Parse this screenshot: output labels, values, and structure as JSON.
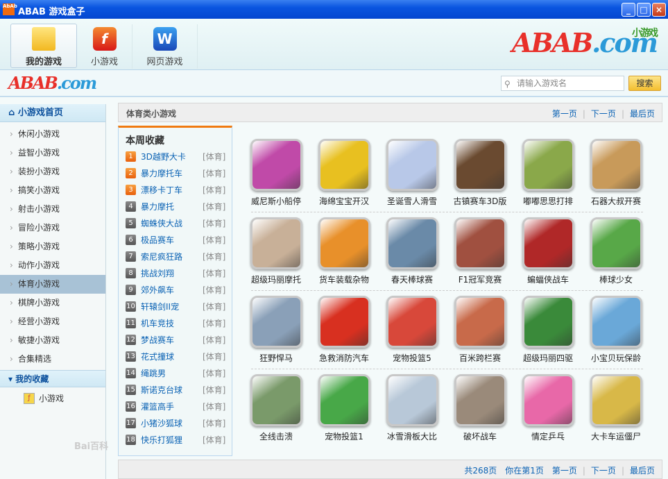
{
  "window": {
    "title": "ABAB  游戏盒子",
    "app_icon": "AbAb",
    "minimize": "_",
    "maximize": "□",
    "close": "×"
  },
  "toolbar": {
    "tabs": [
      {
        "label": "我的游戏",
        "icon": "folder-icon"
      },
      {
        "label": "小游戏",
        "icon": "flash-icon",
        "glyph": "f"
      },
      {
        "label": "网页游戏",
        "icon": "web-icon",
        "glyph": "W"
      }
    ],
    "brand_logo": {
      "main": "ABAB",
      "dot": ".com",
      "sub": "小游戏"
    }
  },
  "search": {
    "placeholder": "请输入游戏名",
    "button": "搜索"
  },
  "sidebar": {
    "home": "小游戏首页",
    "items": [
      "休闲小游戏",
      "益智小游戏",
      "装扮小游戏",
      "搞笑小游戏",
      "射击小游戏",
      "冒险小游戏",
      "策略小游戏",
      "动作小游戏",
      "体育小游戏",
      "棋牌小游戏",
      "经营小游戏",
      "敏捷小游戏",
      "合集精选"
    ],
    "active_index": 8,
    "favorites_header": "我的收藏",
    "favorites": [
      "小游戏"
    ]
  },
  "main": {
    "title": "体育类小游戏",
    "pager": {
      "first": "第一页",
      "next": "下一页",
      "last": "最后页"
    },
    "footer": {
      "total": "共268页",
      "current": "你在第1页",
      "first": "第一页",
      "next": "下一页",
      "last": "最后页"
    }
  },
  "weekly": {
    "title": "本周收藏",
    "items": [
      {
        "n": "1",
        "name": "3D越野大卡",
        "cat": "[体育]"
      },
      {
        "n": "2",
        "name": "暴力摩托车",
        "cat": "[体育]"
      },
      {
        "n": "3",
        "name": "漂移卡丁车",
        "cat": "[体育]"
      },
      {
        "n": "4",
        "name": "暴力摩托",
        "cat": "[体育]"
      },
      {
        "n": "5",
        "name": "蜘蛛侠大战",
        "cat": "[体育]"
      },
      {
        "n": "6",
        "name": "极品赛车",
        "cat": "[体育]"
      },
      {
        "n": "7",
        "name": "索尼疯狂路",
        "cat": "[体育]"
      },
      {
        "n": "8",
        "name": "挑战刘翔",
        "cat": "[体育]"
      },
      {
        "n": "9",
        "name": "郊外飙车",
        "cat": "[体育]"
      },
      {
        "n": "10",
        "name": "轩辕剑II宠",
        "cat": "[体育]"
      },
      {
        "n": "11",
        "name": "机车竞技",
        "cat": "[体育]"
      },
      {
        "n": "12",
        "name": "梦战赛车",
        "cat": "[体育]"
      },
      {
        "n": "13",
        "name": "花式撞球",
        "cat": "[体育]"
      },
      {
        "n": "14",
        "name": "绳跳男",
        "cat": "[体育]"
      },
      {
        "n": "15",
        "name": "斯诺克台球",
        "cat": "[体育]"
      },
      {
        "n": "16",
        "name": "灌篮高手",
        "cat": "[体育]"
      },
      {
        "n": "17",
        "name": "小猪沙狐球",
        "cat": "[体育]"
      },
      {
        "n": "18",
        "name": "快乐打狐狸",
        "cat": "[体育]"
      }
    ]
  },
  "games": [
    {
      "name": "威尼斯小船停",
      "color": "#c04aa8"
    },
    {
      "name": "海绵宝宝开汉",
      "color": "#e8c020"
    },
    {
      "name": "圣诞雪人滑雪",
      "color": "#b8c8e8"
    },
    {
      "name": "古镇赛车3D版",
      "color": "#6a4a30"
    },
    {
      "name": "嘟嘟思思打排",
      "color": "#8aa84a"
    },
    {
      "name": "石器大叔开赛",
      "color": "#c89a5a"
    },
    {
      "name": "超级玛丽摩托",
      "color": "#c8b098"
    },
    {
      "name": "货车装载杂物",
      "color": "#e8902a"
    },
    {
      "name": "春天棒球赛",
      "color": "#6a8aa8"
    },
    {
      "name": "F1冠军竞赛",
      "color": "#a05040"
    },
    {
      "name": "蝙蝠侠战车",
      "color": "#b02828"
    },
    {
      "name": "棒球少女",
      "color": "#58a848"
    },
    {
      "name": "狂野悍马",
      "color": "#8aa0b8"
    },
    {
      "name": "急救消防汽车",
      "color": "#d83020"
    },
    {
      "name": "宠物投篮5",
      "color": "#d8483a"
    },
    {
      "name": "百米跨栏赛",
      "color": "#c86a4a"
    },
    {
      "name": "超级玛丽四驱",
      "color": "#3a8a3a"
    },
    {
      "name": "小宝贝玩保龄",
      "color": "#6aa8d8"
    },
    {
      "name": "全线击溃",
      "color": "#7a9a6a"
    },
    {
      "name": "宠物投篮1",
      "color": "#48a848"
    },
    {
      "name": "冰雪滑板大比",
      "color": "#b8c8d8"
    },
    {
      "name": "破坏战车",
      "color": "#9a8a7a"
    },
    {
      "name": "情定乒乓",
      "color": "#e868a8"
    },
    {
      "name": "大卡车运僵尸",
      "color": "#d8b848"
    }
  ],
  "watermark": "Bai百科"
}
